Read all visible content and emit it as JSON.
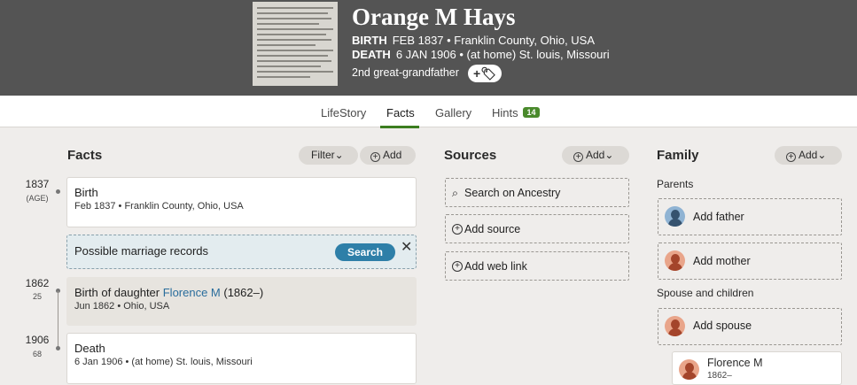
{
  "person": {
    "name": "Orange M Hays",
    "birth_label": "BIRTH",
    "birth_value": "FEB 1837 • Franklin County, Ohio, USA",
    "death_label": "DEATH",
    "death_value": "6 JAN 1906 • (at home) St. louis, Missouri",
    "relationship": "2nd great-grandfather",
    "tag_button": "+🏷"
  },
  "tabs": [
    {
      "label": "LifeStory"
    },
    {
      "label": "Facts"
    },
    {
      "label": "Gallery"
    },
    {
      "label": "Hints"
    }
  ],
  "hints_count": "14",
  "facts": {
    "title": "Facts",
    "filter_label": "Filter",
    "add_label": "Add",
    "timeline": [
      {
        "year": "1837",
        "age": "(AGE)"
      },
      {
        "year": "1862",
        "age": "25"
      },
      {
        "year": "1906",
        "age": "68"
      }
    ],
    "events": [
      {
        "title": "Birth",
        "detail": "Feb 1837 • Franklin County, Ohio, USA"
      },
      {
        "title_prefix": "Birth of daughter ",
        "title_link": "Florence M",
        "title_suffix": " (1862–)",
        "detail": "Jun 1862 • Ohio, USA"
      },
      {
        "title": "Death",
        "detail": "6 Jan 1906 • (at home) St. louis, Missouri"
      }
    ],
    "possible": {
      "text": "Possible marriage records",
      "button": "Search",
      "close": "✕"
    }
  },
  "sources": {
    "title": "Sources",
    "add_label": "Add",
    "actions": [
      {
        "label": "Search on Ancestry"
      },
      {
        "label": "Add source"
      },
      {
        "label": "Add web link"
      }
    ]
  },
  "family": {
    "title": "Family",
    "add_label": "Add",
    "parents_label": "Parents",
    "add_father": "Add father",
    "add_mother": "Add mother",
    "spouse_label": "Spouse and children",
    "add_spouse": "Add spouse",
    "child": {
      "name": "Florence M",
      "years": "1862–"
    }
  },
  "colors": {
    "header_bg": "#545454",
    "accent_green": "#3b7d1f",
    "link_blue": "#2a6d9c",
    "search_button": "#2e7fa8"
  }
}
